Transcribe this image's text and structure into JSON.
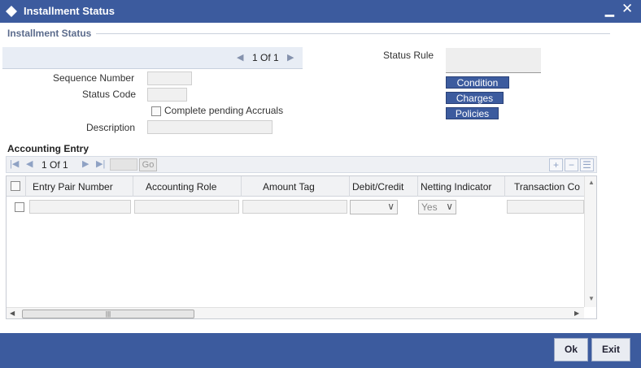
{
  "window": {
    "title": "Installment Status",
    "minimize_glyph": "▁",
    "close_glyph": "✕"
  },
  "section": {
    "title": "Installment Status"
  },
  "record_nav": {
    "page_text": "1 Of 1"
  },
  "form": {
    "sequence_number_label": "Sequence Number",
    "status_code_label": "Status Code",
    "complete_pending_accruals_label": "Complete pending Accruals",
    "description_label": "Description",
    "status_rule_label": "Status Rule"
  },
  "side_buttons": {
    "condition": "Condition",
    "charges": "Charges",
    "policies": "Policies"
  },
  "accounting": {
    "title": "Accounting Entry",
    "page_text": "1 Of 1",
    "go_label": "Go",
    "add_glyph": "+",
    "remove_glyph": "−",
    "list_glyph": "☰",
    "columns": [
      "Entry Pair Number",
      "Accounting Role",
      "Amount Tag",
      "Debit/Credit",
      "Netting Indicator",
      "Transaction Co"
    ],
    "row": {
      "debit_credit_value": "",
      "netting_indicator_value": "Yes"
    }
  },
  "footer": {
    "ok_label": "Ok",
    "exit_label": "Exit"
  },
  "colors": {
    "title_bar": "#3c5b9e",
    "section_title": "#5b6b8c",
    "band": "#e8edf5"
  }
}
